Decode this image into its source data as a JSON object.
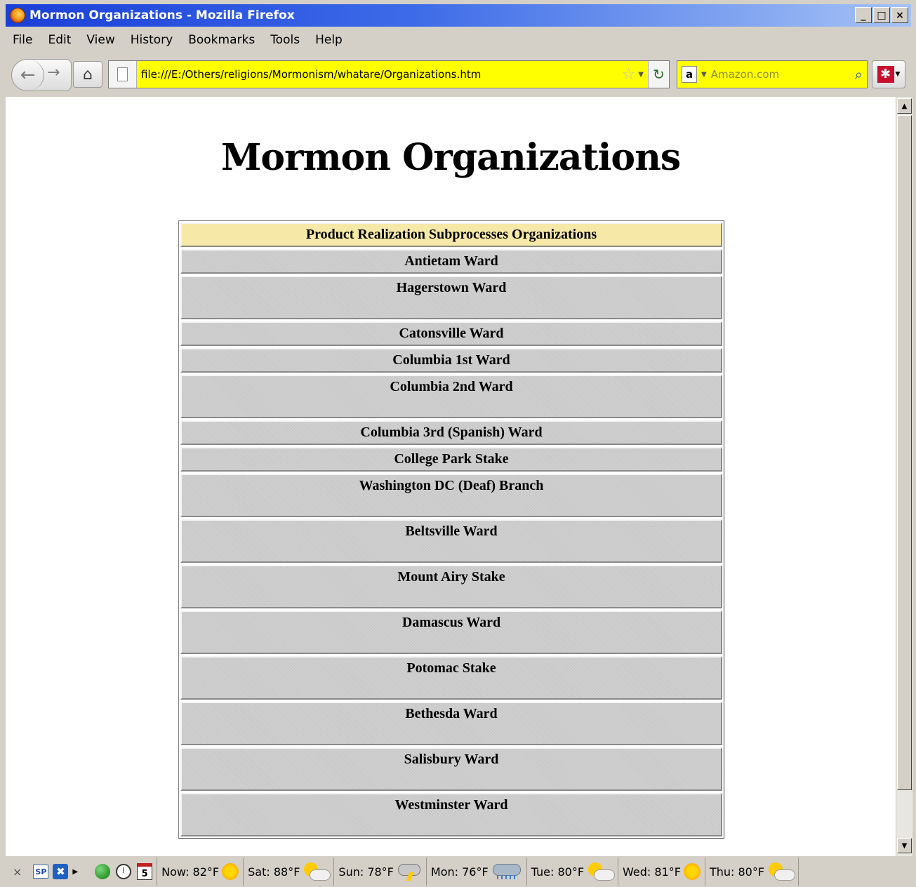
{
  "window": {
    "title": "Mormon Organizations - Mozilla Firefox",
    "controls": [
      "_",
      "□",
      "×"
    ]
  },
  "menu": [
    "File",
    "Edit",
    "View",
    "History",
    "Bookmarks",
    "Tools",
    "Help"
  ],
  "navbar": {
    "url": "file:///E:/Others/religions/Mormonism/whatare/Organizations.htm",
    "search_engine_letter": "a",
    "search_placeholder": "Amazon.com"
  },
  "page": {
    "title": "Mormon Organizations",
    "table_header": "Product Realization Subprocesses Organizations",
    "organizations": [
      {
        "name": "Antietam Ward",
        "size": "short"
      },
      {
        "name": "Hagerstown Ward",
        "size": "tall"
      },
      {
        "name": "Catonsville Ward",
        "size": "short"
      },
      {
        "name": "Columbia 1st Ward",
        "size": "short"
      },
      {
        "name": "Columbia 2nd Ward",
        "size": "tall"
      },
      {
        "name": "Columbia 3rd (Spanish) Ward",
        "size": "short"
      },
      {
        "name": "College Park Stake",
        "size": "short"
      },
      {
        "name": "Washington DC (Deaf) Branch",
        "size": "tall"
      },
      {
        "name": "Beltsville Ward",
        "size": "tall"
      },
      {
        "name": "Mount Airy Stake",
        "size": "tall"
      },
      {
        "name": "Damascus Ward",
        "size": "tall"
      },
      {
        "name": "Potomac Stake",
        "size": "tall"
      },
      {
        "name": "Bethesda Ward",
        "size": "tall"
      },
      {
        "name": "Salisbury Ward",
        "size": "tall"
      },
      {
        "name": "Westminster Ward",
        "size": "tall"
      }
    ]
  },
  "statusbar": {
    "close": "×",
    "sp_label": "SP",
    "calendar_day": "5",
    "weather": [
      {
        "label": "Now: 82°F",
        "icon": "sun-icon"
      },
      {
        "label": "Sat: 88°F",
        "icon": "partly-cloudy-icon"
      },
      {
        "label": "Sun: 78°F",
        "icon": "thunderstorm-icon"
      },
      {
        "label": "Mon: 76°F",
        "icon": "rain-icon"
      },
      {
        "label": "Tue: 80°F",
        "icon": "partly-cloudy-icon"
      },
      {
        "label": "Wed: 81°F",
        "icon": "sun-icon"
      },
      {
        "label": "Thu: 80°F",
        "icon": "partly-cloudy-icon"
      }
    ]
  }
}
